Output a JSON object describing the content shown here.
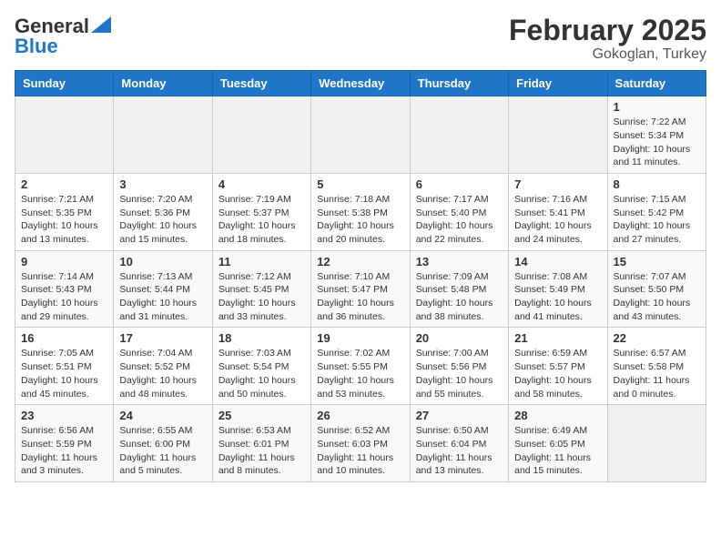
{
  "header": {
    "logo_general": "General",
    "logo_blue": "Blue",
    "month_title": "February 2025",
    "location": "Gokoglan, Turkey"
  },
  "weekdays": [
    "Sunday",
    "Monday",
    "Tuesday",
    "Wednesday",
    "Thursday",
    "Friday",
    "Saturday"
  ],
  "weeks": [
    [
      {
        "day": "",
        "content": ""
      },
      {
        "day": "",
        "content": ""
      },
      {
        "day": "",
        "content": ""
      },
      {
        "day": "",
        "content": ""
      },
      {
        "day": "",
        "content": ""
      },
      {
        "day": "",
        "content": ""
      },
      {
        "day": "1",
        "content": "Sunrise: 7:22 AM\nSunset: 5:34 PM\nDaylight: 10 hours and 11 minutes."
      }
    ],
    [
      {
        "day": "2",
        "content": "Sunrise: 7:21 AM\nSunset: 5:35 PM\nDaylight: 10 hours and 13 minutes."
      },
      {
        "day": "3",
        "content": "Sunrise: 7:20 AM\nSunset: 5:36 PM\nDaylight: 10 hours and 15 minutes."
      },
      {
        "day": "4",
        "content": "Sunrise: 7:19 AM\nSunset: 5:37 PM\nDaylight: 10 hours and 18 minutes."
      },
      {
        "day": "5",
        "content": "Sunrise: 7:18 AM\nSunset: 5:38 PM\nDaylight: 10 hours and 20 minutes."
      },
      {
        "day": "6",
        "content": "Sunrise: 7:17 AM\nSunset: 5:40 PM\nDaylight: 10 hours and 22 minutes."
      },
      {
        "day": "7",
        "content": "Sunrise: 7:16 AM\nSunset: 5:41 PM\nDaylight: 10 hours and 24 minutes."
      },
      {
        "day": "8",
        "content": "Sunrise: 7:15 AM\nSunset: 5:42 PM\nDaylight: 10 hours and 27 minutes."
      }
    ],
    [
      {
        "day": "9",
        "content": "Sunrise: 7:14 AM\nSunset: 5:43 PM\nDaylight: 10 hours and 29 minutes."
      },
      {
        "day": "10",
        "content": "Sunrise: 7:13 AM\nSunset: 5:44 PM\nDaylight: 10 hours and 31 minutes."
      },
      {
        "day": "11",
        "content": "Sunrise: 7:12 AM\nSunset: 5:45 PM\nDaylight: 10 hours and 33 minutes."
      },
      {
        "day": "12",
        "content": "Sunrise: 7:10 AM\nSunset: 5:47 PM\nDaylight: 10 hours and 36 minutes."
      },
      {
        "day": "13",
        "content": "Sunrise: 7:09 AM\nSunset: 5:48 PM\nDaylight: 10 hours and 38 minutes."
      },
      {
        "day": "14",
        "content": "Sunrise: 7:08 AM\nSunset: 5:49 PM\nDaylight: 10 hours and 41 minutes."
      },
      {
        "day": "15",
        "content": "Sunrise: 7:07 AM\nSunset: 5:50 PM\nDaylight: 10 hours and 43 minutes."
      }
    ],
    [
      {
        "day": "16",
        "content": "Sunrise: 7:05 AM\nSunset: 5:51 PM\nDaylight: 10 hours and 45 minutes."
      },
      {
        "day": "17",
        "content": "Sunrise: 7:04 AM\nSunset: 5:52 PM\nDaylight: 10 hours and 48 minutes."
      },
      {
        "day": "18",
        "content": "Sunrise: 7:03 AM\nSunset: 5:54 PM\nDaylight: 10 hours and 50 minutes."
      },
      {
        "day": "19",
        "content": "Sunrise: 7:02 AM\nSunset: 5:55 PM\nDaylight: 10 hours and 53 minutes."
      },
      {
        "day": "20",
        "content": "Sunrise: 7:00 AM\nSunset: 5:56 PM\nDaylight: 10 hours and 55 minutes."
      },
      {
        "day": "21",
        "content": "Sunrise: 6:59 AM\nSunset: 5:57 PM\nDaylight: 10 hours and 58 minutes."
      },
      {
        "day": "22",
        "content": "Sunrise: 6:57 AM\nSunset: 5:58 PM\nDaylight: 11 hours and 0 minutes."
      }
    ],
    [
      {
        "day": "23",
        "content": "Sunrise: 6:56 AM\nSunset: 5:59 PM\nDaylight: 11 hours and 3 minutes."
      },
      {
        "day": "24",
        "content": "Sunrise: 6:55 AM\nSunset: 6:00 PM\nDaylight: 11 hours and 5 minutes."
      },
      {
        "day": "25",
        "content": "Sunrise: 6:53 AM\nSunset: 6:01 PM\nDaylight: 11 hours and 8 minutes."
      },
      {
        "day": "26",
        "content": "Sunrise: 6:52 AM\nSunset: 6:03 PM\nDaylight: 11 hours and 10 minutes."
      },
      {
        "day": "27",
        "content": "Sunrise: 6:50 AM\nSunset: 6:04 PM\nDaylight: 11 hours and 13 minutes."
      },
      {
        "day": "28",
        "content": "Sunrise: 6:49 AM\nSunset: 6:05 PM\nDaylight: 11 hours and 15 minutes."
      },
      {
        "day": "",
        "content": ""
      }
    ]
  ]
}
